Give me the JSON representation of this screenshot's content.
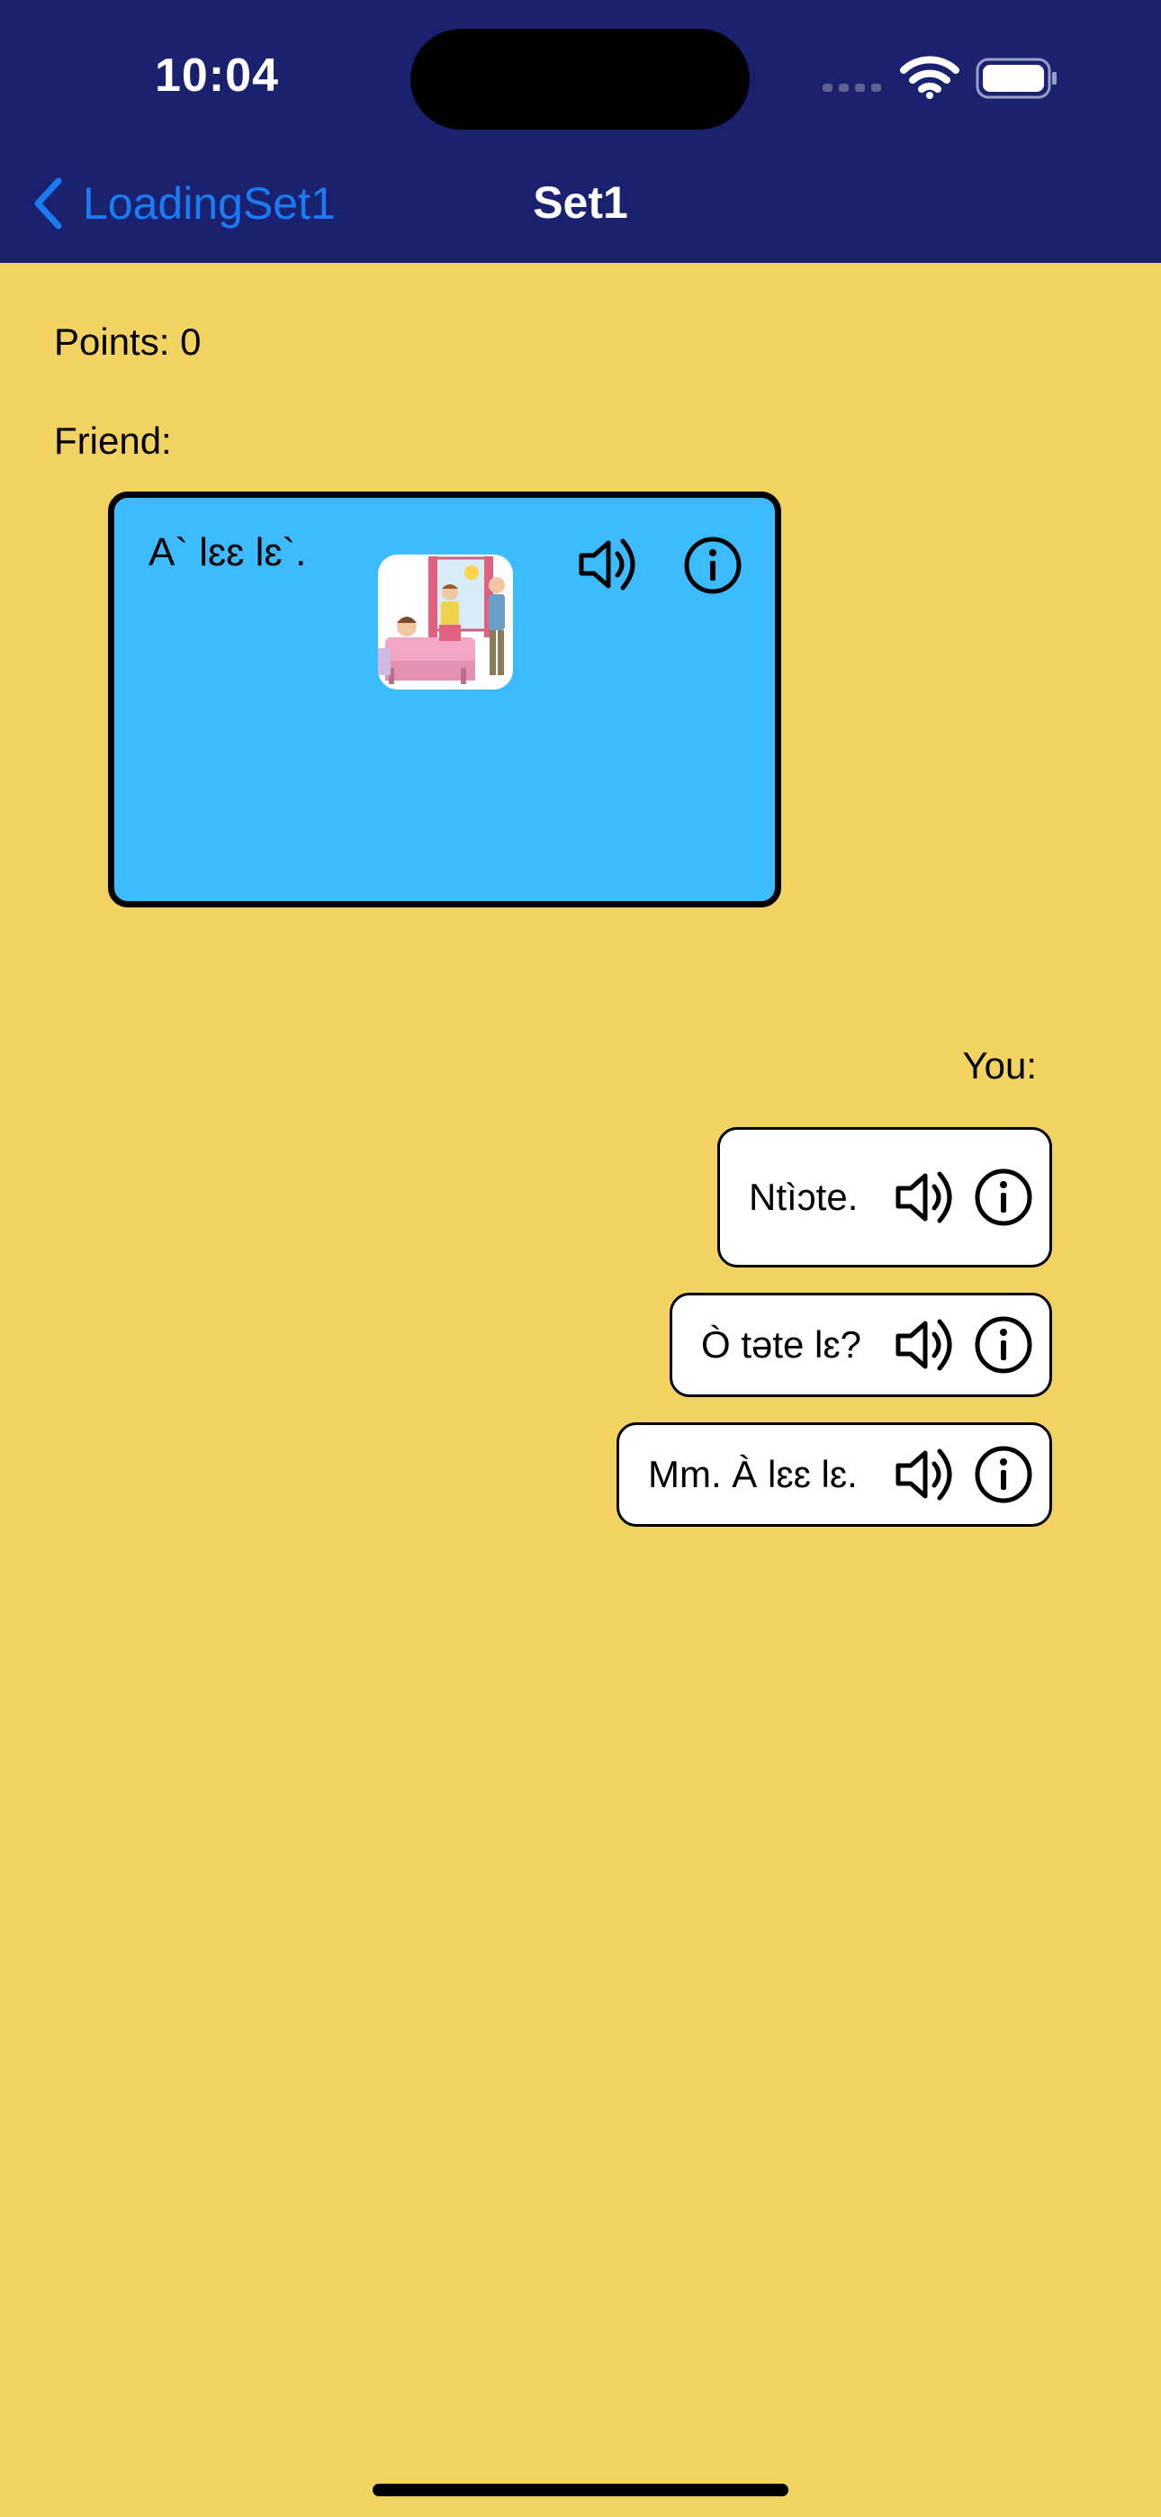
{
  "status_bar": {
    "time": "10:04"
  },
  "nav": {
    "back_label": "LoadingSet1",
    "title": "Set1"
  },
  "points": "Points: 0",
  "friend": {
    "label": "Friend:",
    "text": "A` lɛɛ lɛ`.",
    "image": "bedroom-scene-illustration"
  },
  "you": {
    "label": "You:",
    "replies": [
      {
        "text": "Ntìɔte."
      },
      {
        "text": "Ò təte lɛ?"
      },
      {
        "text": "Mm. À lɛɛ lɛ."
      }
    ]
  },
  "icons": {
    "sound": "speaker-icon",
    "info": "info-icon"
  },
  "colors": {
    "background": "#f2d260",
    "header": "#1a2270",
    "accent": "#1a7bf2",
    "friend_card": "#3cbbff"
  }
}
